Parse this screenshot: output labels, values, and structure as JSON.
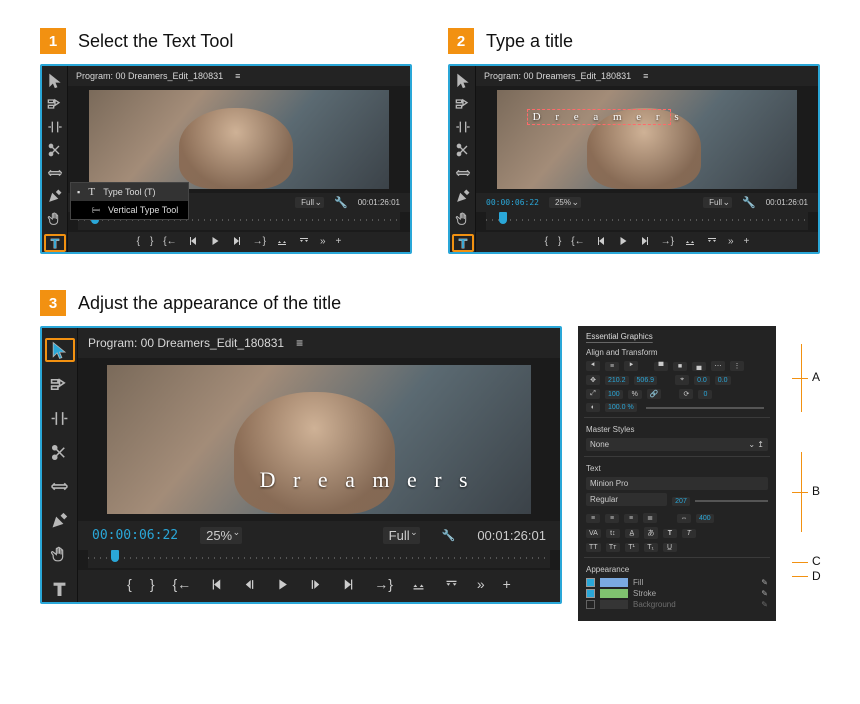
{
  "steps": {
    "one": {
      "num": "1",
      "title": "Select the Text Tool"
    },
    "two": {
      "num": "2",
      "title": "Type a title"
    },
    "three": {
      "num": "3",
      "title": "Adjust the appearance of the title"
    }
  },
  "program": {
    "label": "Program: 00 Dreamers_Edit_180831",
    "menu_icon": "≡"
  },
  "title_text": "D r e a m e r s",
  "timecode": {
    "current": "00:00:06:22",
    "duration": "00:01:26:01"
  },
  "zoom": {
    "value": "25%",
    "fit": "Full"
  },
  "flyout": {
    "type_tool": "Type Tool (T)",
    "vtype_tool": "Vertical Type Tool"
  },
  "eg": {
    "header": "Essential Graphics",
    "section_align": "Align and Transform",
    "pos_x": "210.2",
    "pos_y": "506.9",
    "anchor_x": "0.0",
    "anchor_y": "0.0",
    "scale": "100",
    "scale_pct": "%",
    "rot": "0",
    "opacity": "100.0 %",
    "section_master": "Master Styles",
    "master_value": "None",
    "section_text": "Text",
    "font": "Minion Pro",
    "weight": "Regular",
    "font_size": "207",
    "tracking": "400",
    "section_appearance": "Appearance",
    "fill": "Fill",
    "stroke": "Stroke",
    "background": "Background"
  },
  "callout_labels": {
    "a": "A",
    "b": "B",
    "c": "C",
    "d": "D"
  }
}
